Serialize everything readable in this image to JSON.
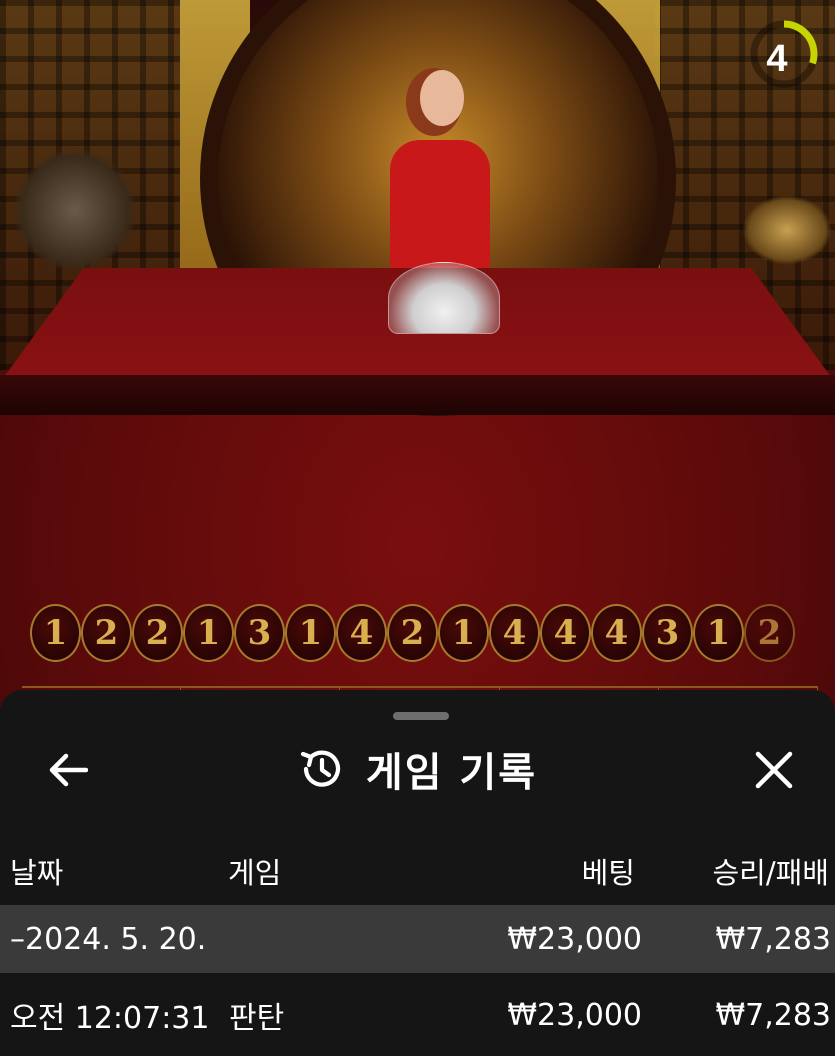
{
  "round_timer": {
    "value": "4",
    "progress": 0.3
  },
  "results": [
    "1",
    "2",
    "2",
    "1",
    "3",
    "1",
    "4",
    "2",
    "1",
    "4",
    "4",
    "4",
    "3",
    "1",
    "2"
  ],
  "sheet": {
    "title": "게임 기록",
    "icons": {
      "back": "arrow-left-icon",
      "history": "history-icon",
      "close": "close-icon"
    }
  },
  "table": {
    "headers": {
      "date": "날짜",
      "game": "게임",
      "bet": "베팅",
      "result": "승리/패배"
    },
    "rows": [
      {
        "date": "–2024. 5. 20.",
        "game": "",
        "bet": "₩23,000",
        "result": "₩7,283"
      },
      {
        "date": "오전 12:07:31",
        "game": "판탄",
        "bet": "₩23,000",
        "result": "₩7,283"
      }
    ]
  },
  "colors": {
    "sheet_bg": "#151515",
    "row_highlight": "#3a3a3a",
    "ball_gold": "#d9b050",
    "timer_arc": "#c8d400"
  }
}
